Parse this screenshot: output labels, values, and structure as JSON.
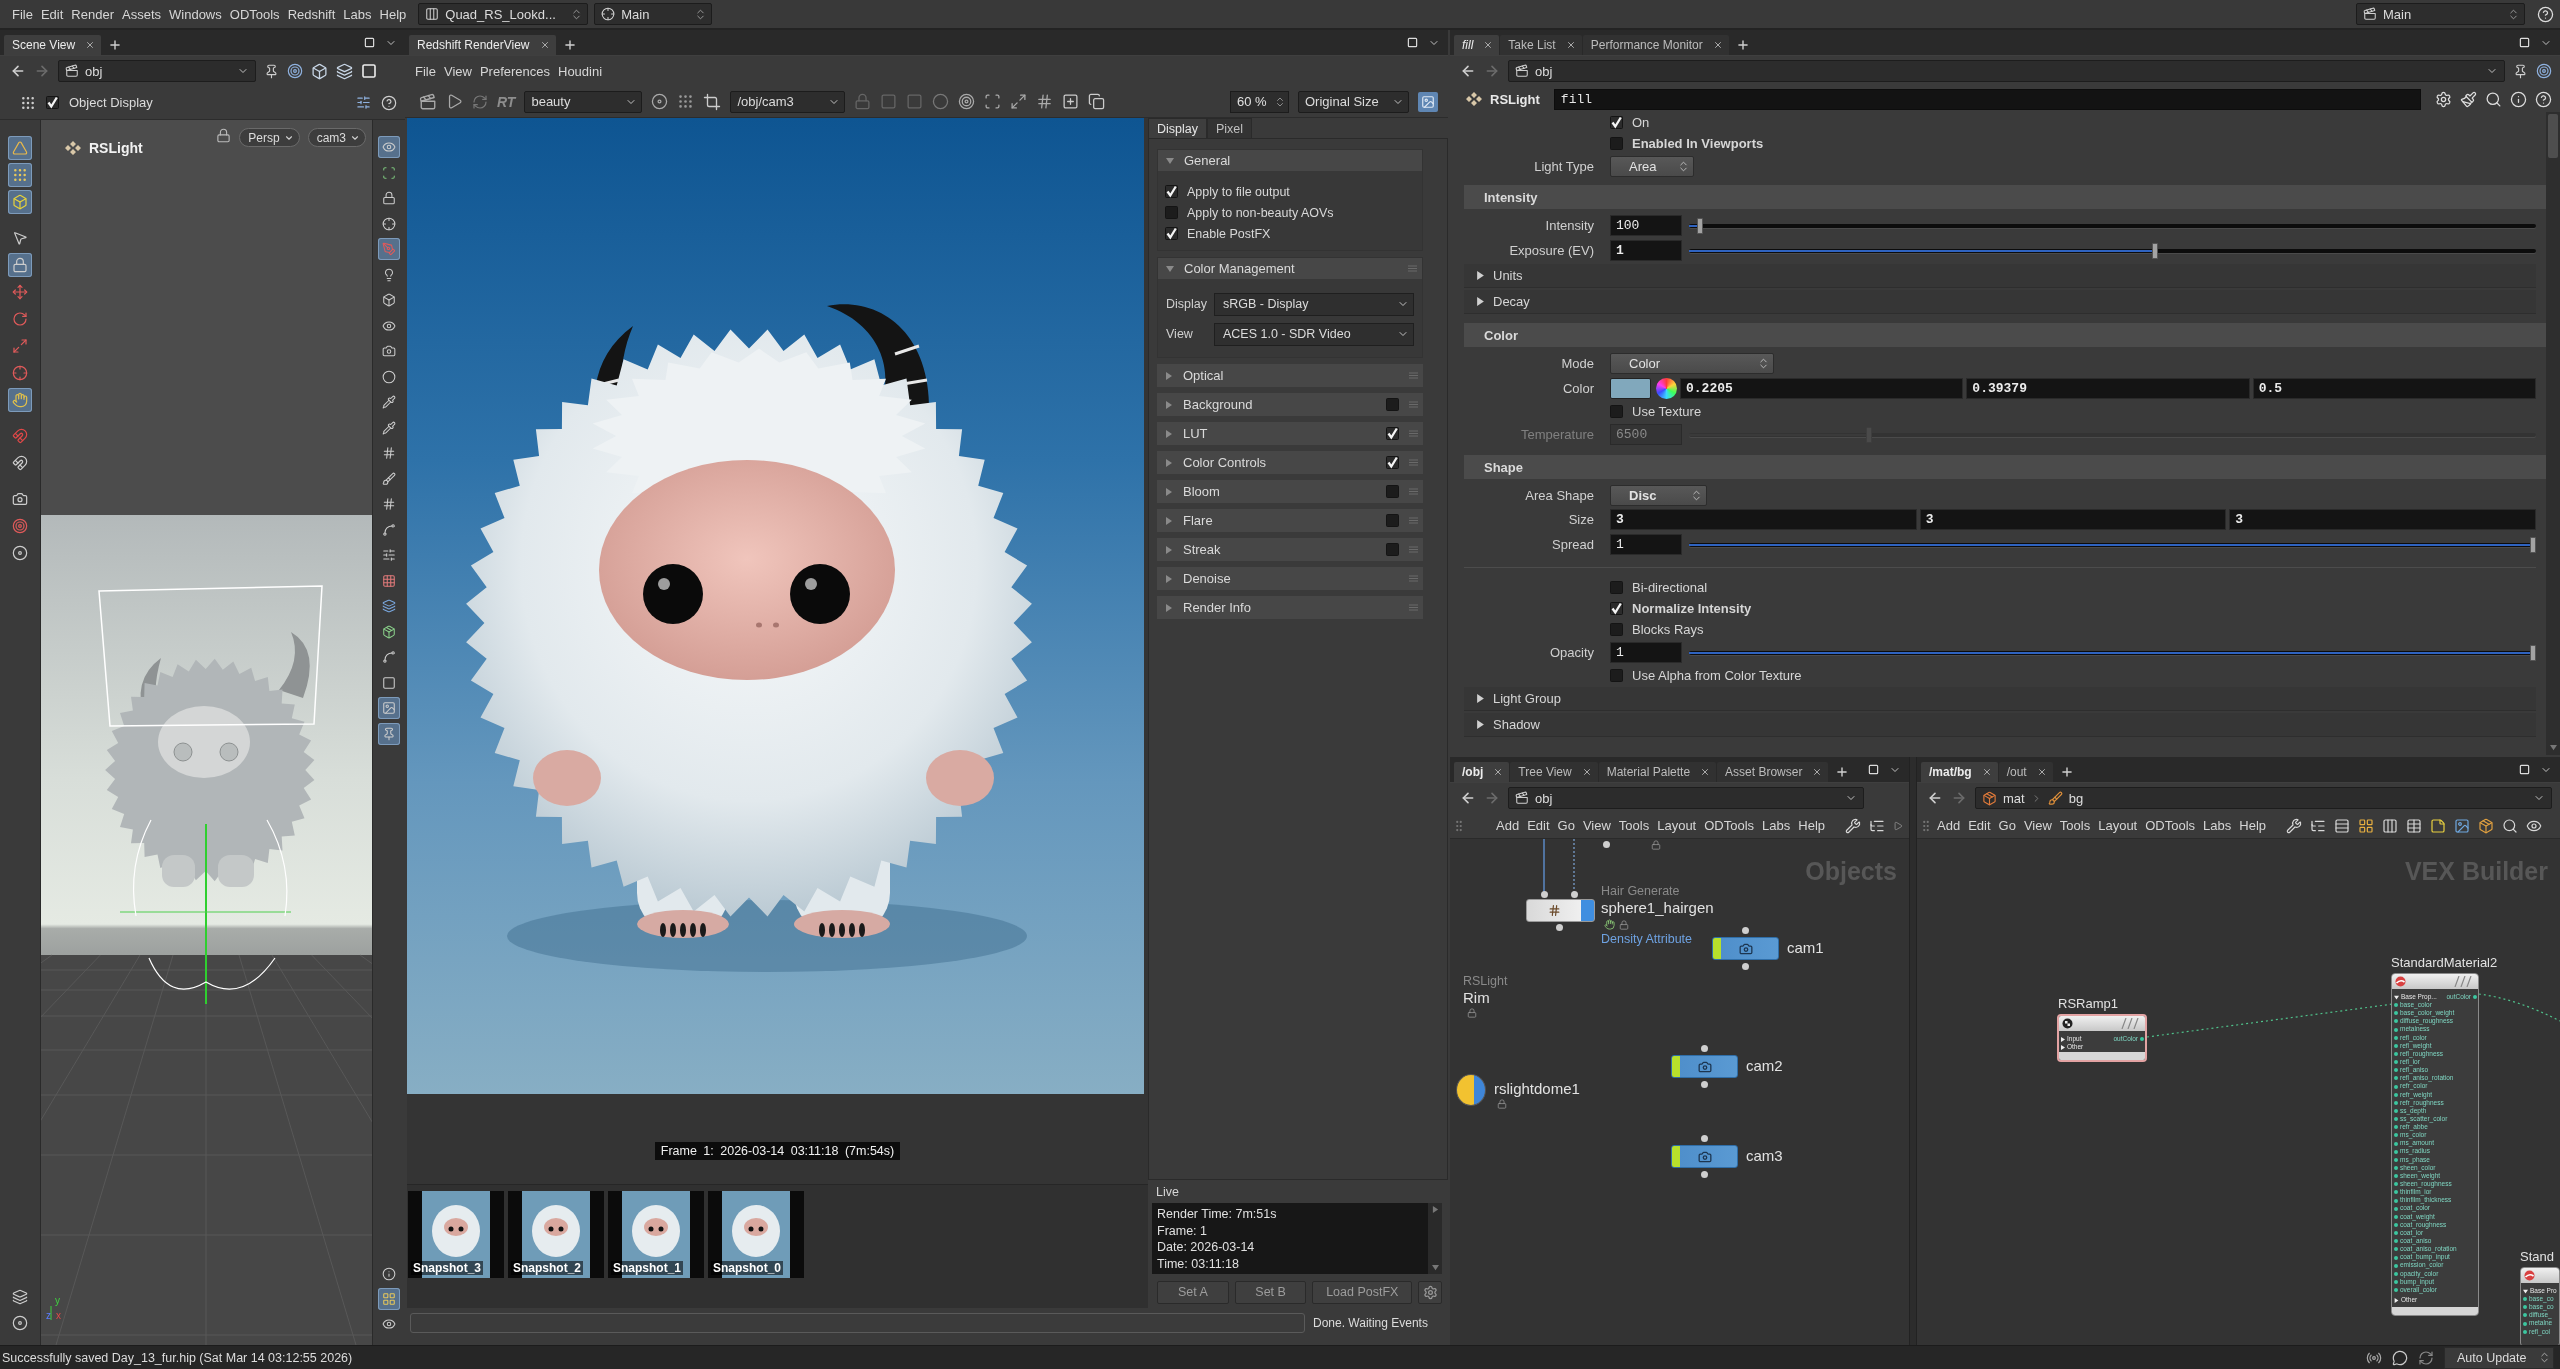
{
  "menu_bar": {
    "items": [
      "File",
      "Edit",
      "Render",
      "Assets",
      "Windows",
      "ODTools",
      "Redshift",
      "Labs",
      "Help"
    ],
    "desktop": "Quad_RS_Lookd...",
    "context": "Main",
    "context_right": "Main"
  },
  "scene_view": {
    "tabs": [
      {
        "label": "Scene View",
        "selected": true
      }
    ],
    "path": "obj",
    "display_option": {
      "label": "Object Display",
      "checked": true
    },
    "viewport_title": "RSLight",
    "view_menus": [
      "Persp",
      "cam3"
    ],
    "axis_labels": [
      "y",
      "z",
      "x"
    ],
    "left_tools": [
      {
        "selected": true
      },
      {
        "selected": true
      },
      {
        "selected": true
      },
      {
        "selected": false
      },
      {
        "selected": true
      },
      {
        "selected": false
      },
      {
        "selected": false
      },
      {
        "selected": false
      },
      {
        "selected": false
      },
      {
        "selected": true
      },
      {
        "selected": false
      },
      {
        "selected": false
      },
      {
        "selected": false
      },
      {
        "selected": false
      },
      {
        "selected": false
      }
    ],
    "left_bottom_tools": [
      {
        "selected": false
      },
      {
        "selected": false
      }
    ],
    "right_tools": [
      {
        "selected": true
      },
      {
        "selected": false
      },
      {
        "selected": false
      },
      {
        "selected": false
      },
      {
        "selected": true
      },
      {
        "selected": false
      },
      {
        "selected": false
      },
      {
        "selected": false
      },
      {
        "selected": false
      },
      {
        "selected": false
      },
      {
        "selected": false
      },
      {
        "selected": false
      },
      {
        "selected": false
      },
      {
        "selected": false
      },
      {
        "selected": false
      },
      {
        "selected": false
      },
      {
        "selected": false
      },
      {
        "selected": false
      },
      {
        "selected": false
      },
      {
        "selected": false
      },
      {
        "selected": false
      },
      {
        "selected": false
      },
      {
        "selected": true
      },
      {
        "selected": true
      }
    ],
    "right_bottom_tools": [
      {
        "selected": false
      },
      {
        "selected": true
      },
      {
        "selected": false
      }
    ]
  },
  "render_view": {
    "tabs": [
      {
        "label": "Redshift RenderView",
        "selected": true
      }
    ],
    "menu": [
      "File",
      "View",
      "Preferences",
      "Houdini"
    ],
    "rt_label": "RT",
    "aov": "beauty",
    "camera": "/obj/cam3",
    "zoom": "60 %",
    "size_mode": "Original Size",
    "frame_info": "Frame 1: 2026-03-14 03:11:18 (7m:54s)",
    "snapshots": [
      "Snapshot_3",
      "Snapshot_2",
      "Snapshot_1",
      "Snapshot_0"
    ],
    "panel_tabs": [
      {
        "label": "Display",
        "selected": true
      },
      {
        "label": "Pixel",
        "selected": false
      }
    ],
    "sections": [
      {
        "kind": "group",
        "title": "General",
        "expanded": true,
        "options": [
          {
            "label": "Apply to file output",
            "checked": true
          },
          {
            "label": "Apply to non-beauty AOVs",
            "checked": false
          },
          {
            "label": "Enable PostFX",
            "checked": true
          }
        ]
      },
      {
        "kind": "group",
        "title": "Color Management",
        "expanded": true,
        "fields": [
          {
            "label": "Display",
            "value": "sRGB - Display"
          },
          {
            "label": "View",
            "value": "ACES 1.0 - SDR Video"
          }
        ]
      },
      {
        "kind": "plain",
        "title": "Optical",
        "expanded": false
      },
      {
        "kind": "toggle",
        "title": "Background",
        "expanded": false,
        "checked": false
      },
      {
        "kind": "toggle",
        "title": "LUT",
        "expanded": false,
        "checked": true
      },
      {
        "kind": "toggle",
        "title": "Color Controls",
        "expanded": false,
        "checked": true
      },
      {
        "kind": "toggle",
        "title": "Bloom",
        "expanded": false,
        "checked": false
      },
      {
        "kind": "toggle",
        "title": "Flare",
        "expanded": false,
        "checked": false
      },
      {
        "kind": "toggle",
        "title": "Streak",
        "expanded": false,
        "checked": false
      },
      {
        "kind": "plain",
        "title": "Denoise",
        "expanded": false
      },
      {
        "kind": "plain",
        "title": "Render Info",
        "expanded": false
      }
    ],
    "live_title": "Live",
    "live_lines": [
      "Render Time: 7m:51s",
      "Frame: 1",
      "Date: 2026-03-14",
      "Time: 03:11:18"
    ],
    "buttons": [
      "Set A",
      "Set B",
      "Load PostFX"
    ],
    "progress": {
      "level": 0
    },
    "status": "Done. Waiting Events"
  },
  "parameters": {
    "tabs": [
      {
        "label": "fill",
        "selected": true
      },
      {
        "label": "Take List",
        "selected": false
      },
      {
        "label": "Performance Monitor",
        "selected": false
      }
    ],
    "path": "obj",
    "node_type": "RSLight",
    "node_name": "fill",
    "rows": [
      {
        "kind": "checkbox",
        "label": "On",
        "checked": true,
        "modified": false
      },
      {
        "kind": "checkbox",
        "label": "Enabled In Viewports",
        "checked": false,
        "modified": true
      },
      {
        "kind": "menu",
        "label": "Light Type",
        "value": "Area",
        "modified": false
      },
      {
        "kind": "section",
        "label": "Intensity"
      },
      {
        "kind": "slider",
        "label": "Intensity",
        "value": "100",
        "level": 0.01,
        "disabled": false,
        "modified": false
      },
      {
        "kind": "slider",
        "label": "Exposure (EV)",
        "value": "1",
        "level": 0.55,
        "disabled": false,
        "modified": true
      },
      {
        "kind": "folder",
        "label": "Units",
        "expanded": false
      },
      {
        "kind": "folder",
        "label": "Decay",
        "expanded": false
      },
      {
        "kind": "section",
        "label": "Color"
      },
      {
        "kind": "menu",
        "label": "Mode",
        "value": "Color",
        "modified": false
      },
      {
        "kind": "color",
        "label": "Color",
        "values": [
          "0.2205",
          "0.39379",
          "0.5"
        ],
        "modified": true
      },
      {
        "kind": "checkbox",
        "label": "Use Texture",
        "checked": false,
        "modified": false
      },
      {
        "kind": "slider",
        "label": "Temperature",
        "value": "6500",
        "level": 0.21,
        "disabled": true,
        "modified": false
      },
      {
        "kind": "section",
        "label": "Shape"
      },
      {
        "kind": "menu",
        "label": "Area Shape",
        "value": "Disc",
        "modified": true
      },
      {
        "kind": "vector",
        "label": "Size",
        "values": [
          "3",
          "3",
          "3"
        ],
        "modified": true
      },
      {
        "kind": "slider",
        "label": "Spread",
        "value": "1",
        "level": 1,
        "disabled": false,
        "modified": false
      },
      {
        "kind": "separator"
      },
      {
        "kind": "checkbox",
        "label": "Bi-directional",
        "checked": false,
        "modified": false
      },
      {
        "kind": "checkbox",
        "label": "Normalize Intensity",
        "checked": true,
        "modified": true
      },
      {
        "kind": "checkbox",
        "label": "Blocks Rays",
        "checked": false,
        "modified": false
      },
      {
        "kind": "slider",
        "label": "Opacity",
        "value": "1",
        "level": 1,
        "disabled": false,
        "modified": false
      },
      {
        "kind": "checkbox",
        "label": "Use Alpha from Color Texture",
        "checked": false,
        "modified": false
      },
      {
        "kind": "folder",
        "label": "Light Group",
        "expanded": false
      },
      {
        "kind": "folder",
        "label": "Shadow",
        "expanded": false
      }
    ]
  },
  "obj_network": {
    "tabs": [
      {
        "label": "/obj",
        "selected": true
      },
      {
        "label": "Tree View",
        "selected": false
      },
      {
        "label": "Material Palette",
        "selected": false
      },
      {
        "label": "Asset Browser",
        "selected": false
      }
    ],
    "path": [
      "obj"
    ],
    "menu": [
      "Add",
      "Edit",
      "Go",
      "View",
      "Tools",
      "Layout",
      "ODTools",
      "Labs",
      "Help"
    ],
    "context_label": "Objects",
    "nodes": [
      {
        "kind": "hair",
        "type_label": "Hair Generate",
        "name": "sphere1_hairgen",
        "note": "Density Attribute"
      },
      {
        "kind": "camera",
        "name": "cam1"
      },
      {
        "kind": "light",
        "type_label": "RSLight",
        "name": "Rim"
      },
      {
        "kind": "dome",
        "name": "rslightdome1"
      },
      {
        "kind": "camera",
        "name": "cam2"
      },
      {
        "kind": "camera",
        "name": "cam3"
      }
    ]
  },
  "vex_network": {
    "tabs": [
      {
        "label": "/mat/bg",
        "selected": true
      },
      {
        "label": "/out",
        "selected": false
      }
    ],
    "path": [
      "mat",
      "bg"
    ],
    "menu": [
      "Add",
      "Edit",
      "Go",
      "View",
      "Tools",
      "Layout",
      "ODTools",
      "Labs",
      "Help"
    ],
    "context_label": "VEX Builder",
    "nodes": [
      {
        "kind": "ramp",
        "name": "RSRamp1",
        "selected": true,
        "inputs": [
          "Input",
          "Other"
        ],
        "output": "outColor"
      },
      {
        "kind": "material",
        "name": "StandardMaterial2",
        "selected": false,
        "group": "Base Prop...",
        "output": "outColor",
        "inputs": [
          "base_color",
          "base_color_weight",
          "diffuse_roughness",
          "metalness",
          "refl_color",
          "refl_weight",
          "refl_roughness",
          "refl_ior",
          "refl_aniso",
          "refl_aniso_rotation",
          "refr_color",
          "refr_weight",
          "refr_roughness",
          "ss_depth",
          "ss_scatter_color",
          "refr_abbe",
          "ms_color",
          "ms_amount",
          "ms_radius",
          "ms_phase",
          "sheen_color",
          "sheen_weight",
          "sheen_roughness",
          "thinfilm_ior",
          "thinfilm_thickness",
          "coat_color",
          "coat_weight",
          "coat_roughness",
          "coat_ior",
          "coat_aniso",
          "coat_aniso_rotation",
          "coat_bump_input",
          "emission_color",
          "opacity_color",
          "bump_input",
          "overall_color"
        ],
        "more": "Other"
      },
      {
        "kind": "material",
        "name": "Stand",
        "selected": false,
        "group": "Base Pro",
        "inputs": [
          "base_co",
          "base_co",
          "diffuse_",
          "metalne",
          "refl_col"
        ]
      }
    ]
  },
  "status_bar": {
    "message": "Successfully saved Day_13_fur.hip (Sat Mar 14 03:12:55 2026)",
    "update_mode": "Auto Update"
  }
}
